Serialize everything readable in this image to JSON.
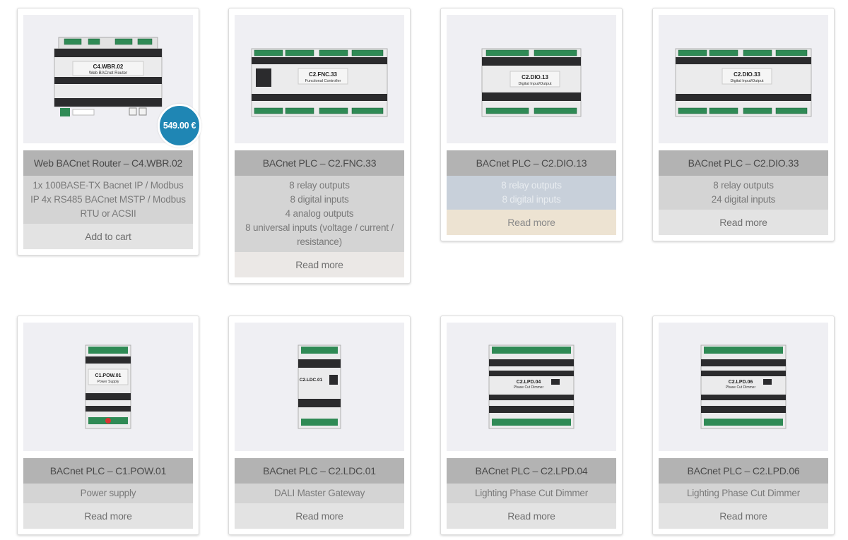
{
  "products": [
    {
      "title": "Web BACnet Router – C4.WBR.02",
      "model": "C4.WBR.02",
      "subtitle": "Web BACnet Router",
      "desc": [
        "1x 100BASE-TX Bacnet IP / Modbus IP 4x RS485 BACnet MSTP / Modbus RTU or ACSII"
      ],
      "action": "Add to cart",
      "price": "549.00 €",
      "icon": "router-device-image"
    },
    {
      "title": "BACnet PLC – C2.FNC.33",
      "model": "C2.FNC.33",
      "subtitle": "Functional Controller",
      "desc": [
        "8 relay outputs",
        "8 digital inputs",
        "4 analog outputs",
        "8 universal inputs (voltage / current / resistance)"
      ],
      "action": "Read more",
      "icon": "plc-device-image"
    },
    {
      "title": "BACnet PLC – C2.DIO.13",
      "model": "C2.DIO.13",
      "subtitle": "Digital Input/Output",
      "desc": [
        "8 relay outputs",
        "8 digital inputs"
      ],
      "action": "Read more",
      "icon": "plc-device-image"
    },
    {
      "title": "BACnet PLC – C2.DIO.33",
      "model": "C2.DIO.33",
      "subtitle": "Digital Input/Output",
      "desc": [
        "8 relay outputs",
        "24 digital inputs"
      ],
      "action": "Read more",
      "icon": "plc-device-image"
    },
    {
      "title": "BACnet PLC – C1.POW.01",
      "model": "C1.POW.01",
      "subtitle": "Power Supply",
      "desc": [
        "Power supply"
      ],
      "action": "Read more",
      "icon": "power-supply-device-image"
    },
    {
      "title": "BACnet PLC – C2.LDC.01",
      "model": "C2.LDC.01",
      "subtitle": "",
      "desc": [
        "DALI Master Gateway"
      ],
      "action": "Read more",
      "icon": "gateway-device-image"
    },
    {
      "title": "BACnet PLC – C2.LPD.04",
      "model": "C2.LPD.04",
      "subtitle": "Phase Cut Dimmer",
      "desc": [
        "Lighting Phase Cut Dimmer"
      ],
      "action": "Read more",
      "icon": "dimmer-device-image"
    },
    {
      "title": "BACnet PLC – C2.LPD.06",
      "model": "C2.LPD.06",
      "subtitle": "Phase Cut Dimmer",
      "desc": [
        "Lighting Phase Cut Dimmer"
      ],
      "action": "Read more",
      "icon": "dimmer-device-image"
    }
  ],
  "colors": {
    "title_bg": "#b3b3b3",
    "desc_bg": "#d4d4d4",
    "action_bg": "#e3e3e3",
    "image_bg": "#efeff3",
    "price_badge": "#1f86b4",
    "terminal_green": "#2f8a55"
  }
}
